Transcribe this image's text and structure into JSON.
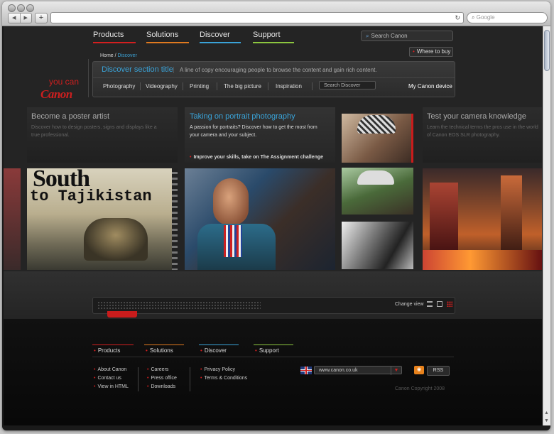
{
  "browser": {
    "back": "◀",
    "forward": "▶",
    "new_tab": "+",
    "reload": "↻",
    "search_placeholder": "Google"
  },
  "nav": {
    "items": [
      {
        "label": "Products",
        "color": "#d41f1f"
      },
      {
        "label": "Solutions",
        "color": "#e07a1f"
      },
      {
        "label": "Discover",
        "color": "#3aa3d8"
      },
      {
        "label": "Support",
        "color": "#8cc63f"
      }
    ],
    "search": "Search Canon",
    "where_to_buy": "Where to buy"
  },
  "breadcrumb": {
    "home": "Home",
    "sep": "/",
    "current": "Discover"
  },
  "section": {
    "title": "Discover section title",
    "description": "A line of copy encouraging people to browse the content and gain rich content.",
    "subnav": [
      "Photography",
      "Videography",
      "Printing",
      "The big picture",
      "Inspiration"
    ],
    "search": "Search Discover",
    "my_device": "My Canon device"
  },
  "brand": {
    "tagline": "you can",
    "logo": "Canon"
  },
  "features": {
    "left": {
      "title": "Become a poster artist",
      "desc": "Discover how to design posters, signs and displays like a true professional."
    },
    "center": {
      "title": "Taking on portrait photography",
      "desc": "A passion for portraits? Discover how to get the most from your camera and your subject.",
      "link": "Improve your skills, take on The Assignment challenge"
    },
    "right": {
      "title": "Test your camera knowledge",
      "desc": "Learn the technical terms the pros use in the world of Canon EOS SLR photography."
    }
  },
  "posters": {
    "line1": "South",
    "line2": "to Tajikistan"
  },
  "strip": {
    "change_view": "Change view"
  },
  "footer": {
    "nav": [
      {
        "label": "Products",
        "color": "#d41f1f"
      },
      {
        "label": "Solutions",
        "color": "#e07a1f"
      },
      {
        "label": "Discover",
        "color": "#3aa3d8"
      },
      {
        "label": "Support",
        "color": "#8cc63f"
      }
    ],
    "col1": [
      "About Canon",
      "Contact us",
      "View in HTML"
    ],
    "col2": [
      "Careers",
      "Press office",
      "Downloads"
    ],
    "col3": [
      "Privacy Policy",
      "Terms & Conditions"
    ],
    "site": "www.canon.co.uk",
    "rss": "RSS",
    "copyright": "Canon Copyright 2008"
  }
}
